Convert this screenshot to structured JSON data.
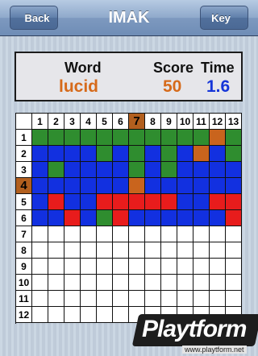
{
  "nav": {
    "title": "IMAK",
    "back_label": "Back",
    "key_label": "Key"
  },
  "scoreboard": {
    "word_label": "Word",
    "word_value": "lucid",
    "score_label": "Score",
    "score_value": "50",
    "time_label": "Time",
    "time_value": "1.6"
  },
  "colors": {
    "G": "#2f8d2f",
    "B": "#1230e0",
    "R": "#e81c1c",
    "O": "#c9641d",
    "W": "#ffffff",
    "highlight": "#b25f1e"
  },
  "grid": {
    "active_column": "7",
    "active_row": "4",
    "column_labels": [
      "1",
      "2",
      "3",
      "4",
      "5",
      "6",
      "7",
      "8",
      "9",
      "10",
      "11",
      "12",
      "13"
    ],
    "row_labels": [
      "1",
      "2",
      "3",
      "4",
      "5",
      "6",
      "7",
      "8",
      "9",
      "10",
      "11",
      "12"
    ],
    "rows": [
      "GGGGGGGGGGGOG",
      "BBBBGBGBGBOBG",
      "BGBBBBGBGBBBB",
      "BBBBBBOBBBBBB",
      "BRBBRRRRRBBRR",
      "BBRBGRBBBBBBR",
      "WWWWWWWWWWWWW",
      "WWWWWWWWWWWWW",
      "WWWWWWWWWWWWW",
      "WWWWWWWWWWWWW",
      "WWWWWWWWWWWWW",
      "WWWWWWWWWWWWW"
    ]
  },
  "watermark": {
    "brand": "Playtform",
    "url": "www.playtform.net"
  }
}
